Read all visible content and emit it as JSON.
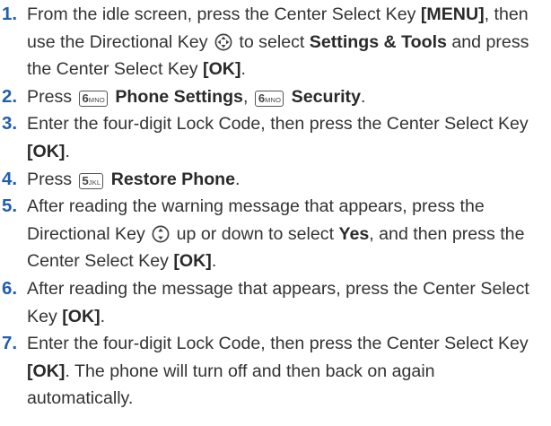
{
  "steps": [
    {
      "num": "1.",
      "t1": "From the idle screen, press the Center Select Key ",
      "b1": "[MENU]",
      "t2": ", then use the Directional Key ",
      "t3": " to select ",
      "b2": "Settings & Tools",
      "t4": " and press the Center Select Key ",
      "b3": "[OK]",
      "t5": "."
    },
    {
      "num": "2.",
      "t1": "Press ",
      "key1": {
        "digit": "6",
        "letters": "MNO"
      },
      "b1": "Phone Settings",
      "t2": ", ",
      "key2": {
        "digit": "6",
        "letters": "MNO"
      },
      "b2": "Security",
      "t3": "."
    },
    {
      "num": "3.",
      "t1": "Enter the four-digit Lock Code, then press the Center Select Key ",
      "b1": "[OK]",
      "t2": "."
    },
    {
      "num": "4.",
      "t1": "Press ",
      "key1": {
        "digit": "5",
        "letters": "JKL"
      },
      "b1": "Restore Phone",
      "t2": "."
    },
    {
      "num": "5.",
      "t1": "After reading the warning message that appears, press the Directional Key ",
      "t2": " up or down to select ",
      "b1": "Yes",
      "t3": ", and then press the Center Select Key ",
      "b2": "[OK]",
      "t4": "."
    },
    {
      "num": "6.",
      "t1": "After reading the message that appears, press the Center Select Key ",
      "b1": "[OK]",
      "t2": "."
    },
    {
      "num": "7.",
      "t1": "Enter the four-digit Lock Code, then press the Center Select Key ",
      "b1": "[OK]",
      "t2": ". The phone will turn off and then back on again automatically."
    }
  ],
  "icons": {
    "directional_4way": "directional-key-4way-icon",
    "directional_updown": "directional-key-updown-icon"
  },
  "colors": {
    "step_number": "#1f5fb0",
    "text": "#333333"
  }
}
